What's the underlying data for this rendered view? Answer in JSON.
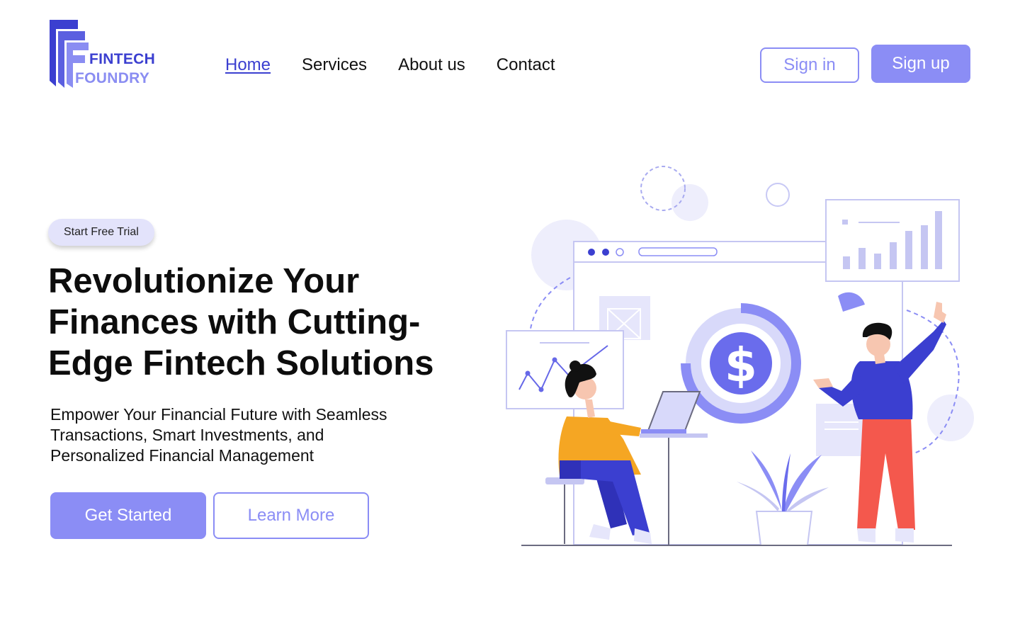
{
  "brand": {
    "name_line1": "FINTECH",
    "name_line2": "FOUNDRY",
    "primary_color": "#3b3fd0",
    "accent_color": "#8b8df5"
  },
  "nav": {
    "items": [
      {
        "label": "Home",
        "active": true
      },
      {
        "label": "Services",
        "active": false
      },
      {
        "label": "About us",
        "active": false
      },
      {
        "label": "Contact",
        "active": false
      }
    ]
  },
  "auth": {
    "signin_label": "Sign in",
    "signup_label": "Sign up"
  },
  "hero": {
    "badge_label": "Start Free Trial",
    "headline": "Revolutionize Your Finances with Cutting-Edge Fintech Solutions",
    "subtext": "Empower Your Financial Future with Seamless Transactions, Smart Investments, and Personalized Financial Management",
    "primary_cta": "Get Started",
    "secondary_cta": "Learn More"
  },
  "illustration": {
    "icon": "fintech-team-illustration",
    "currency_symbol": "$"
  }
}
